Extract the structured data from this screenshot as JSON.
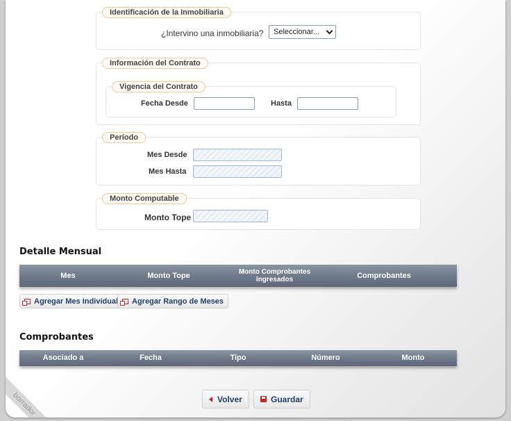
{
  "inmobiliaria": {
    "legend": "Identificación de la Inmobiliaria",
    "question": "¿Intervino una inmobiliaria?",
    "select_value": "Seleccionar..."
  },
  "contrato": {
    "legend": "Información del Contrato",
    "vigencia_legend": "Vigencia del Contrato",
    "fecha_desde_label": "Fecha Desde",
    "fecha_desde_value": "",
    "hasta_label": "Hasta",
    "hasta_value": ""
  },
  "periodo": {
    "legend": "Período",
    "mes_desde_label": "Mes Desde",
    "mes_hasta_label": "Mes Hasta"
  },
  "monto": {
    "legend": "Monto Computable",
    "tope_label": "Monto Tope"
  },
  "detalle": {
    "title": "Detalle Mensual",
    "columns": [
      "Mes",
      "Monto Tope",
      "Monto Comprobantes Ingresados",
      "Comprobantes"
    ],
    "add_individual": "Agregar Mes Individual",
    "add_range": "Agregar Rango de Meses"
  },
  "comprobantes": {
    "title": "Comprobantes",
    "columns": [
      "Asociado a",
      "Fecha",
      "Tipo",
      "Número",
      "Monto"
    ]
  },
  "actions": {
    "back": "Volver",
    "save": "Guardar"
  },
  "watermark": "borrador",
  "colors": {
    "legend_border": "#f3c895",
    "table_header": "#6d7888",
    "button_text": "#1f3f6f",
    "icon_red": "#cc2222"
  }
}
